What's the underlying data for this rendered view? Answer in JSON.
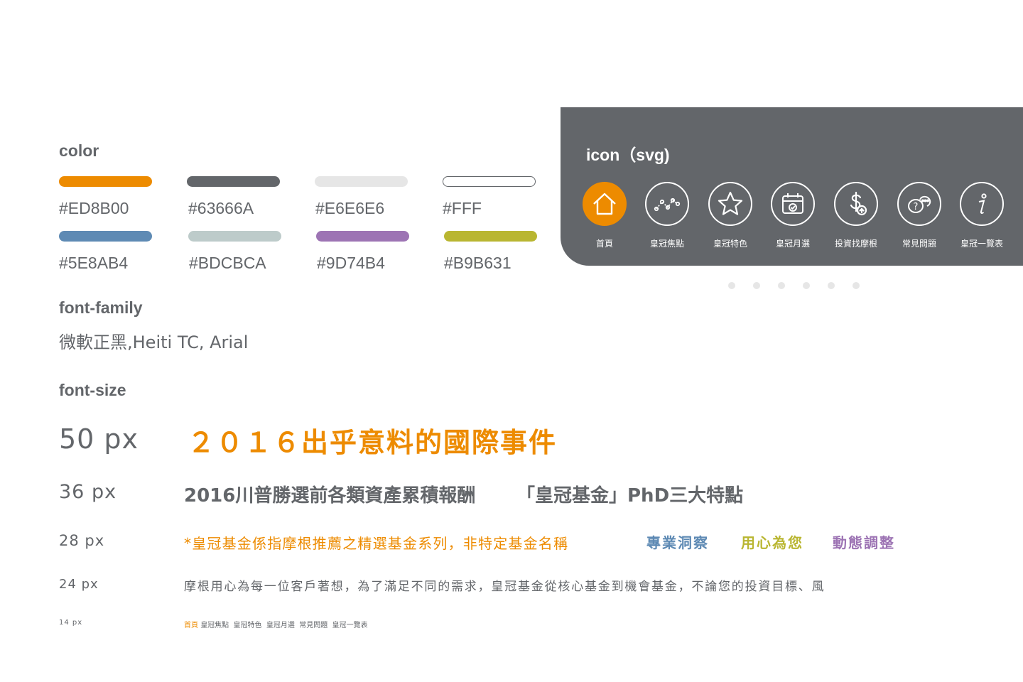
{
  "color_section": {
    "title": "color",
    "swatches": [
      {
        "hex": "#ED8B00",
        "label": "#ED8B00"
      },
      {
        "hex": "#63666A",
        "label": "#63666A"
      },
      {
        "hex": "#E6E6E6",
        "label": "#E6E6E6"
      },
      {
        "hex": "#FFFFFF",
        "label": "#FFF"
      },
      {
        "hex": "#5E8AB4",
        "label": "#5E8AB4"
      },
      {
        "hex": "#BDCBCA",
        "label": "#BDCBCA"
      },
      {
        "hex": "#9D74B4",
        "label": "#9D74B4"
      },
      {
        "hex": "#B9B631",
        "label": "#B9B631"
      }
    ]
  },
  "font_family": {
    "title": "font-family",
    "value": "微軟正黑,Heiti TC, Arial"
  },
  "font_size": {
    "title": "font-size",
    "rows": {
      "s50": {
        "label": "50 px",
        "sample": "２０１６出乎意料的國際事件"
      },
      "s36": {
        "label": "36 px",
        "sample_a": "2016川普勝選前各類資產累積報酬",
        "sample_b": "「皇冠基金」PhD三大特點"
      },
      "s28": {
        "label": "28 px",
        "sample_a": "*皇冠基金係指摩根推薦之精選基金系列，非特定基金名稱",
        "tag_1": "專業洞察",
        "tag_2": "用心為您",
        "tag_3": "動態調整"
      },
      "s24": {
        "label": "24 px",
        "sample": "摩根用心為每一位客戶著想，為了滿足不同的需求，皇冠基金從核心基金到機會基金，不論您的投資目標、風"
      },
      "s14": {
        "label": "14 px",
        "first": "首頁",
        "rest": "皇冠焦點  皇冠特色  皇冠月選  常見問題  皇冠一覽表"
      }
    }
  },
  "icon_section": {
    "title": "icon（svg)",
    "items": [
      {
        "label": "首頁",
        "icon": "home-icon"
      },
      {
        "label": "皇冠焦點",
        "icon": "trend-line-icon"
      },
      {
        "label": "皇冠特色",
        "icon": "star-icon"
      },
      {
        "label": "皇冠月選",
        "icon": "calendar-check-icon"
      },
      {
        "label": "投資找摩根",
        "icon": "dollar-upload-icon"
      },
      {
        "label": "常見問題",
        "icon": "chat-question-icon"
      },
      {
        "label": "皇冠一覽表",
        "icon": "info-icon"
      }
    ]
  },
  "colors": {
    "orange": "#ED8B00",
    "gray": "#63666A",
    "blue": "#5E8AB4",
    "green": "#B9B631",
    "purple": "#9D74B4"
  }
}
